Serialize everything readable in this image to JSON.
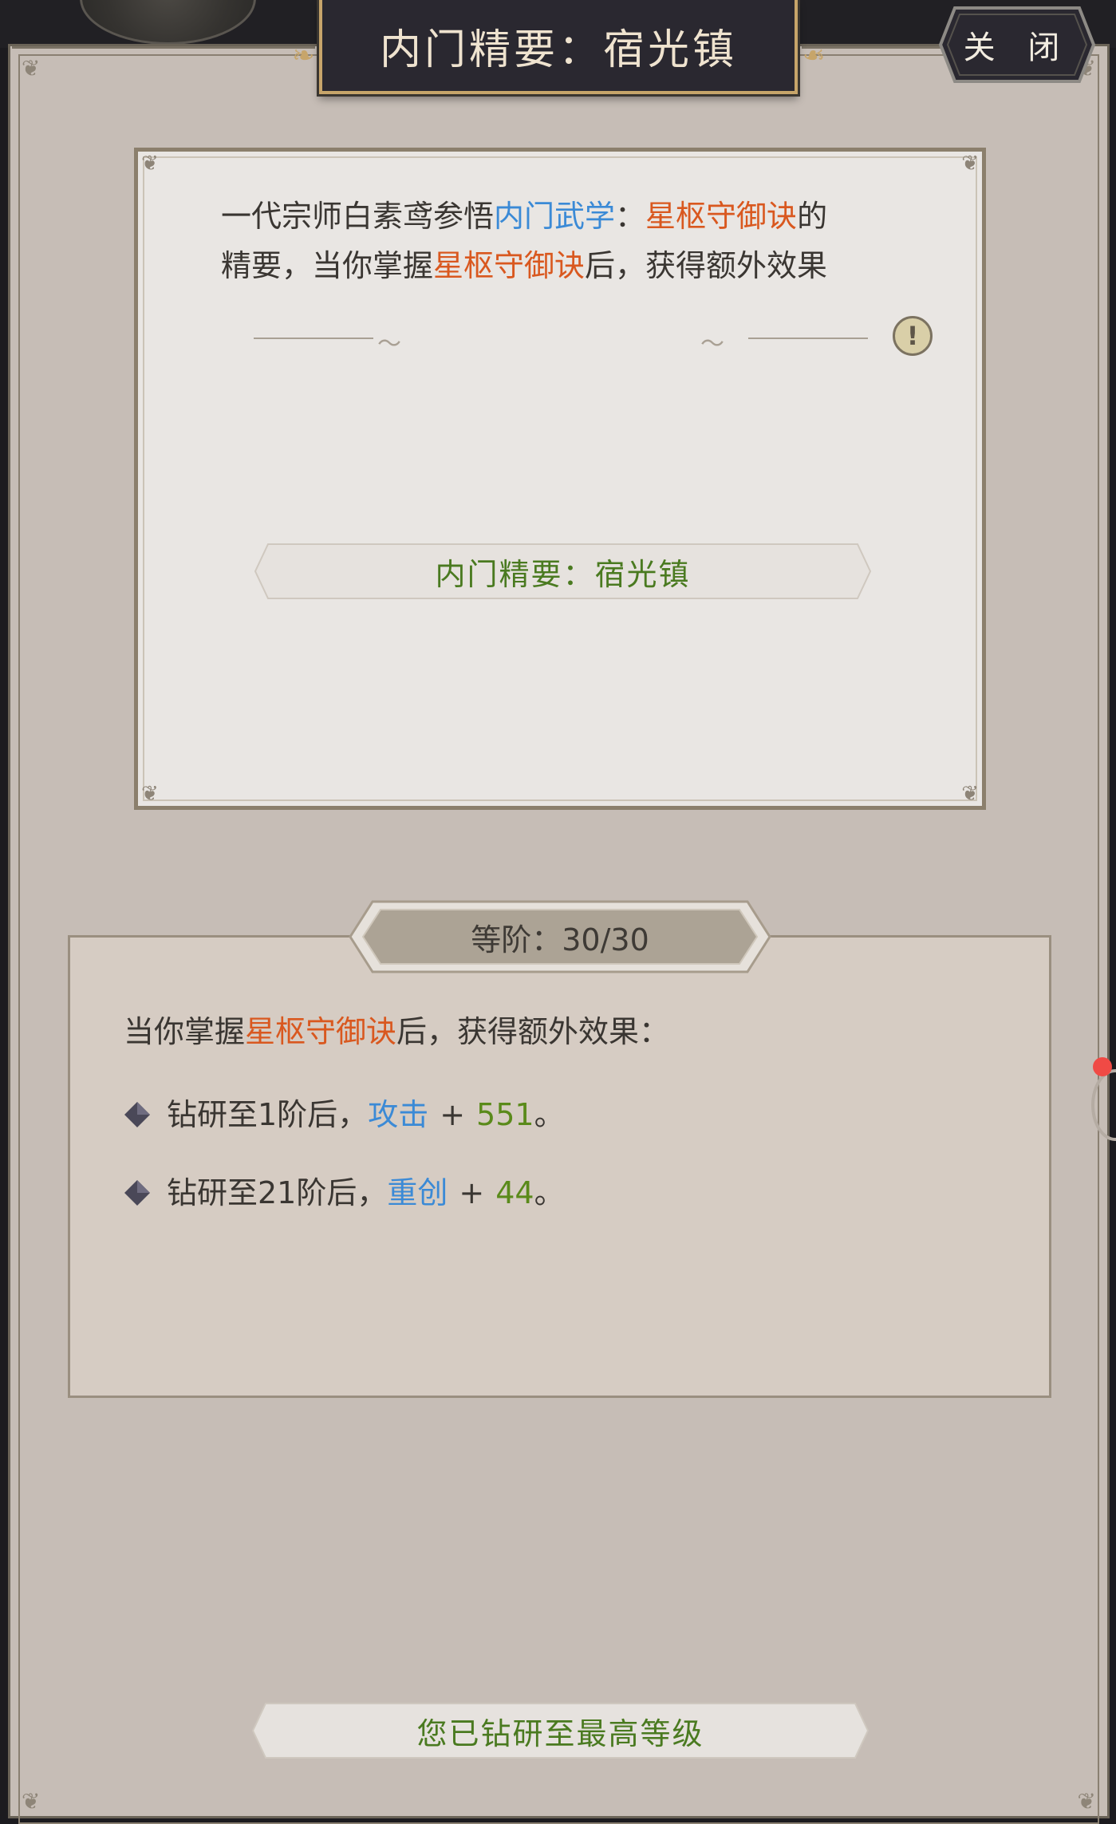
{
  "window": {
    "title": "内门精要：宿光镇",
    "close_label": "关 闭"
  },
  "description": {
    "part1": "一代宗师白素鸢参悟",
    "tag_type": "内门武学",
    "colon": "：",
    "skill_name": "星枢守御诀",
    "part2": "的",
    "part3": "精要，当你掌握",
    "skill_name_2": "星枢守御诀",
    "part4": "后，获得额外效果"
  },
  "warning_icon_glyph": "!",
  "card_banner": "内门精要：宿光镇",
  "level": {
    "label": "等阶：30/30",
    "current": 30,
    "max": 30
  },
  "effects": {
    "heading_pre": "当你掌握",
    "heading_skill": "星枢守御诀",
    "heading_post": "后，获得额外效果：",
    "items": [
      {
        "prefix": "钻研至1阶后，",
        "stat": "攻击",
        "plus": "+",
        "value": "551",
        "suffix": "。"
      },
      {
        "prefix": "钻研至21阶后，",
        "stat": "重创",
        "plus": "+",
        "value": "44",
        "suffix": "。"
      }
    ]
  },
  "bottom_status": "您已钻研至最高等级",
  "colors": {
    "accent_blue": "#3b8ad6",
    "accent_orange": "#d9581f",
    "accent_green": "#5a8a1a",
    "panel": "#c6bdb6"
  }
}
